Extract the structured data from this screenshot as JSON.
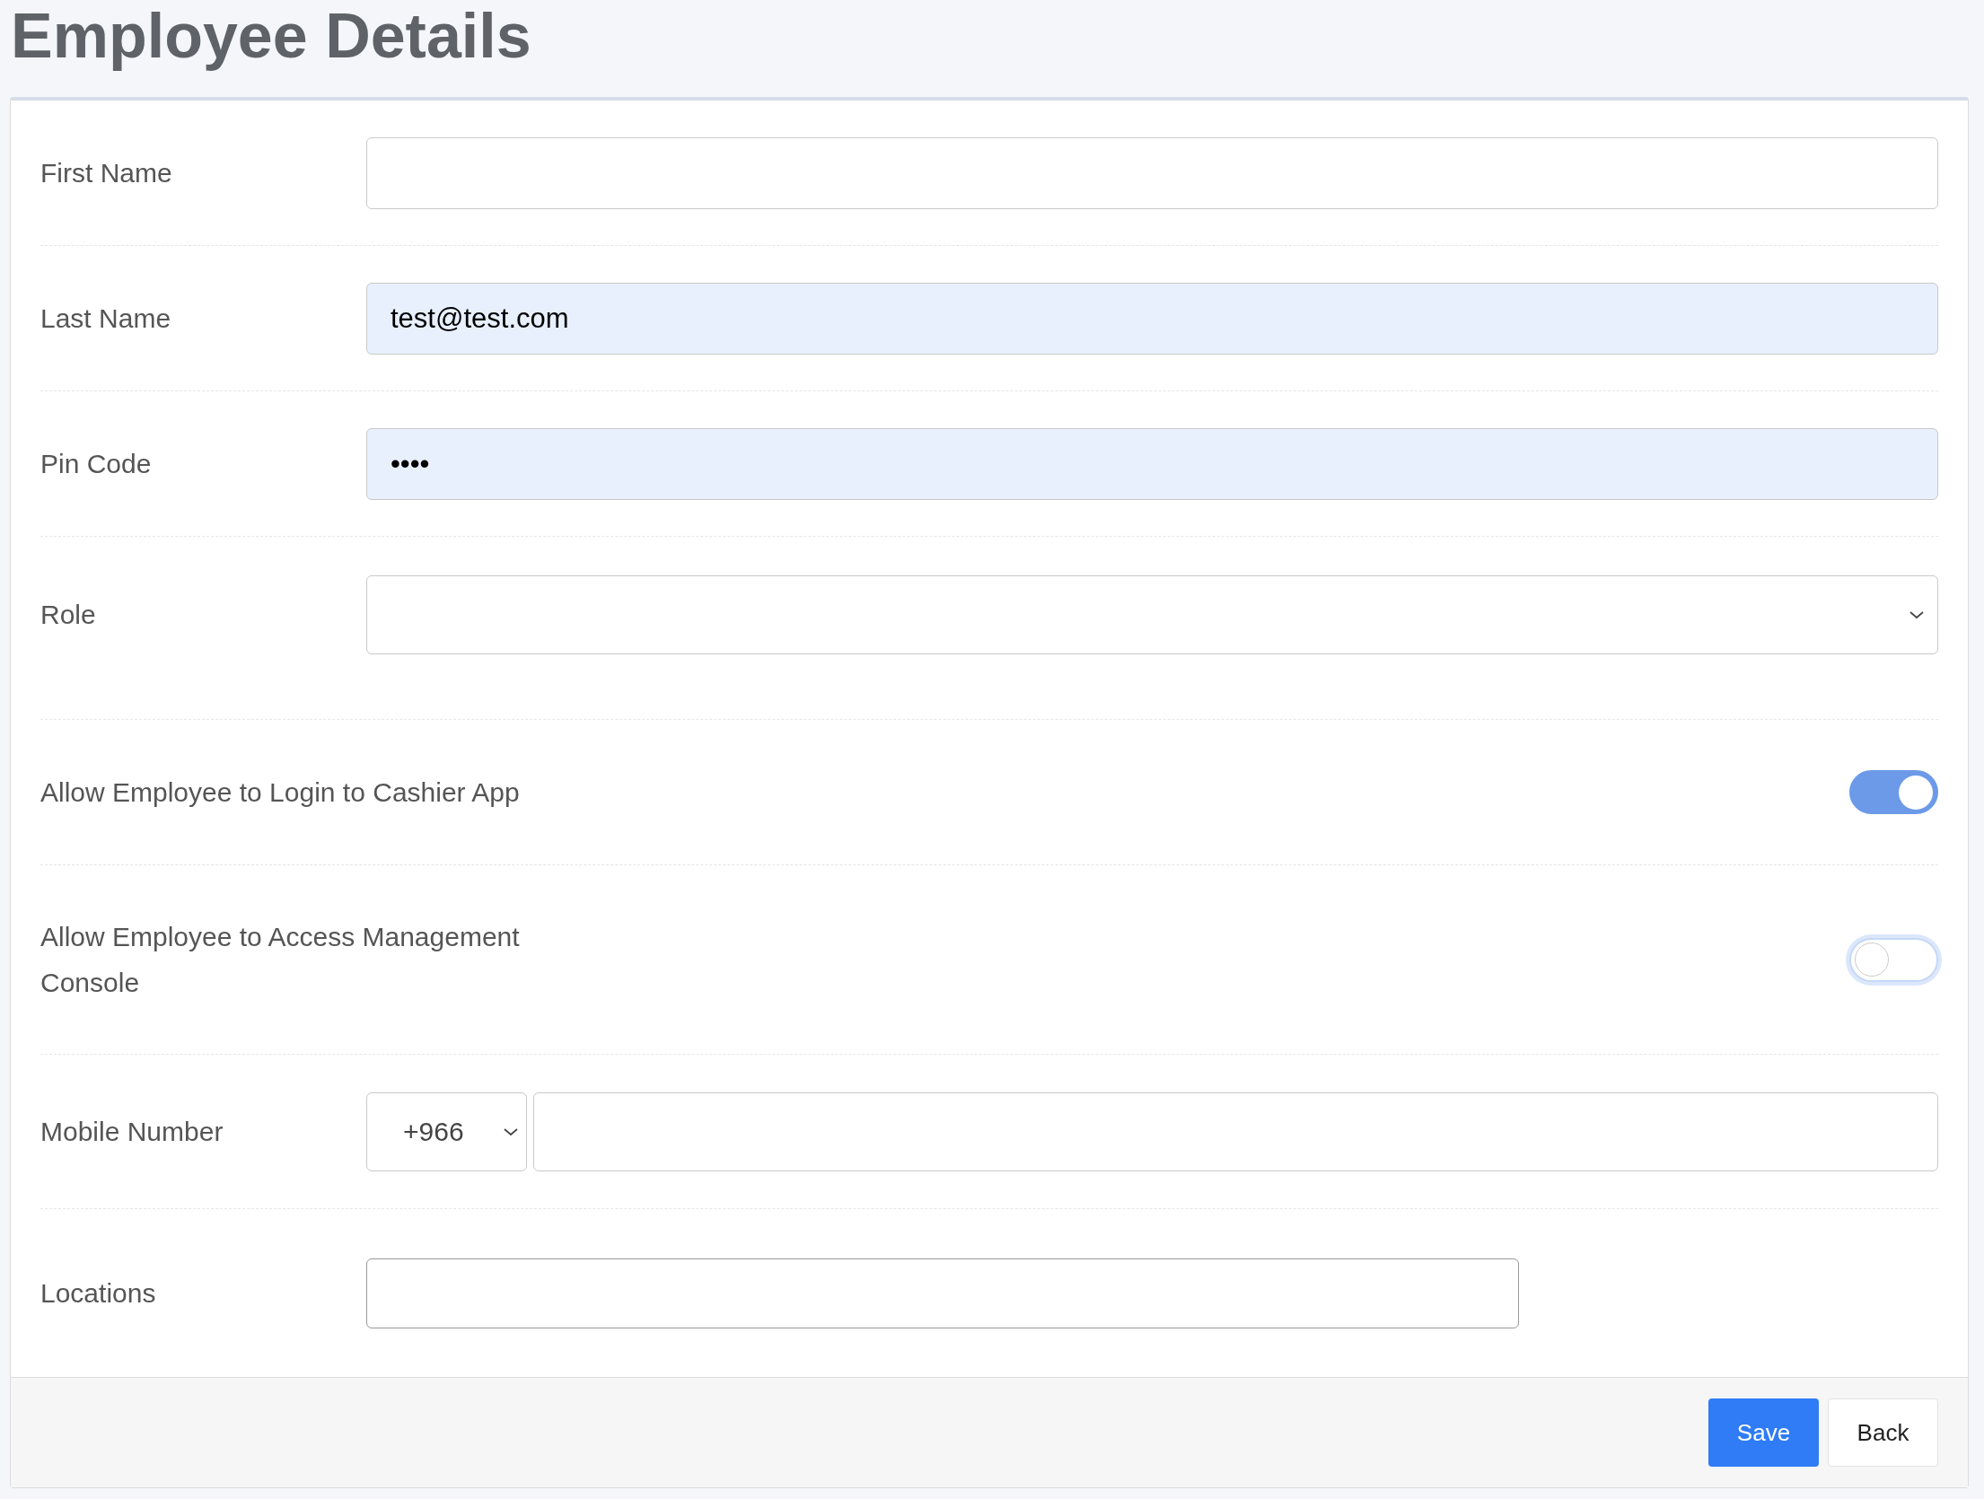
{
  "title": "Employee Details",
  "fields": [
    {
      "kind": "text",
      "label": "First Name",
      "autofilled": false
    },
    {
      "kind": "text",
      "label": "Last Name",
      "value": "test@test.com",
      "autofilled": true
    },
    {
      "kind": "text",
      "label": "Pin Code",
      "value": "••••",
      "autofilled": true
    },
    {
      "kind": "select",
      "label": "Role"
    },
    {
      "kind": "toggle",
      "label": "Allow Employee to Login to Cashier App",
      "on": true,
      "focused": false
    },
    {
      "kind": "toggle",
      "label": "Allow Employee to Access Management Console",
      "on": false,
      "focused": true
    },
    {
      "kind": "phone",
      "label": "Mobile Number",
      "country_code": "+966"
    },
    {
      "kind": "locations",
      "label": "Locations"
    }
  ],
  "buttons": [
    {
      "label": "Save",
      "primary": true
    },
    {
      "label": "Back",
      "primary": false
    }
  ]
}
